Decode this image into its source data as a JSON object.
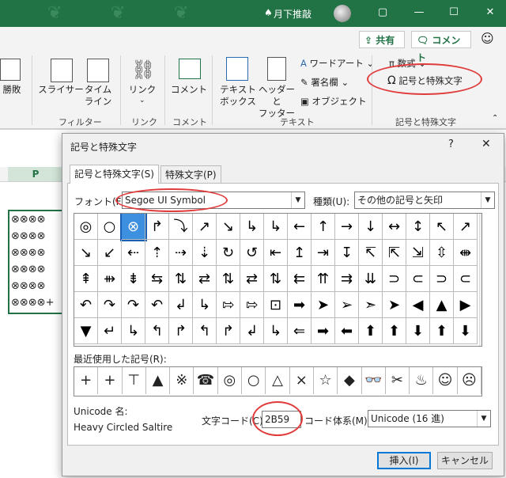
{
  "titlebar": {
    "user": "月下推敲",
    "controls": [
      "▢",
      "—",
      "☐",
      "✕"
    ]
  },
  "ribbon": {
    "share_label": "共有",
    "comment_label": "コメント",
    "smiley": "☺",
    "items": {
      "shouhai": "勝敗",
      "slicer": "スライサー",
      "timeline": "タイム\nライン",
      "link": "リンク",
      "comment": "コメント",
      "textbox": "テキスト\nボックス",
      "header_footer": "ヘッダーと\nフッター",
      "wordart": "ワードアート",
      "signature": "署名欄",
      "object": "オブジェクト",
      "equation": "数式",
      "symbol": "記号と特殊文字"
    },
    "groups": {
      "filter": "フィルター",
      "link": "リンク",
      "comment": "コメント",
      "text": "テキスト",
      "symbols": "記号と特殊文字"
    }
  },
  "sheet": {
    "column_header": "P",
    "cells": [
      "⊗⊗⊗⊗",
      "⊗⊗⊗⊗",
      "⊗⊗⊗⊗",
      "⊗⊗⊗⊗",
      "⊗⊗⊗⊗",
      "⊗⊗⊗⊗+"
    ]
  },
  "dialog": {
    "title": "記号と特殊文字",
    "help": "?",
    "close": "✕",
    "tabs": [
      "記号と特殊文字(S)",
      "特殊文字(P)"
    ],
    "font_label": "フォント(F):",
    "font_value": "Segoe UI Symbol",
    "subset_label": "種類(U):",
    "subset_value": "その他の記号と矢印",
    "symbols": [
      [
        "◎",
        "○",
        "⊗",
        "↱",
        "⤵",
        "↗",
        "↘",
        "↳",
        "↳",
        "←",
        "↑",
        "→",
        "↓",
        "↔",
        "↕",
        "↖",
        "↗"
      ],
      [
        "↘",
        "↙",
        "⇠",
        "⇡",
        "⇢",
        "⇣",
        "↻",
        "↺",
        "⇤",
        "↥",
        "⇥",
        "↧",
        "↸",
        "⇱",
        "⇲",
        "⇳",
        "⇼"
      ],
      [
        "⇞",
        "⇻",
        "⇟",
        "⇆",
        "⇅",
        "⇄",
        "⇅",
        "⇄",
        "⇅",
        "⇇",
        "⇈",
        "⇉",
        "⇊",
        "⊃",
        "⊂",
        "⊃",
        "⊂"
      ],
      [
        "↶",
        "↷",
        "↷",
        "↶",
        "↲",
        "↳",
        "⇰",
        "⇰",
        "⊡",
        "➡",
        "➤",
        "➢",
        "➣",
        "➤",
        "◀",
        "▲",
        "▶"
      ],
      [
        "▼",
        "↵",
        "↳",
        "↰",
        "↱",
        "↰",
        "↱",
        "↲",
        "↳",
        "⇐",
        "➡",
        "⬅",
        "⬆",
        "⬆",
        "⬇",
        "⬆",
        "⬇"
      ]
    ],
    "recent_label": "最近使用した記号(R):",
    "recent": [
      "+",
      "+",
      "⊤",
      "▲",
      "※",
      "☎",
      "◎",
      "○",
      "△",
      "×",
      "☆",
      "◆",
      "👓",
      "✂",
      "♨",
      "☺",
      "☹"
    ],
    "unicode_name_label": "Unicode 名:",
    "unicode_name": "Heavy Circled Saltire",
    "charcode_label": "文字コード(C):",
    "charcode_value": "2B59",
    "from_label": "コード体系(M):",
    "from_value": "Unicode (16 進)",
    "insert": "挿入(I)",
    "cancel": "キャンセル"
  },
  "colors": {
    "accent": "#217346",
    "highlight": "#e03c3c",
    "selected_symbol": "#3d8fe0"
  }
}
